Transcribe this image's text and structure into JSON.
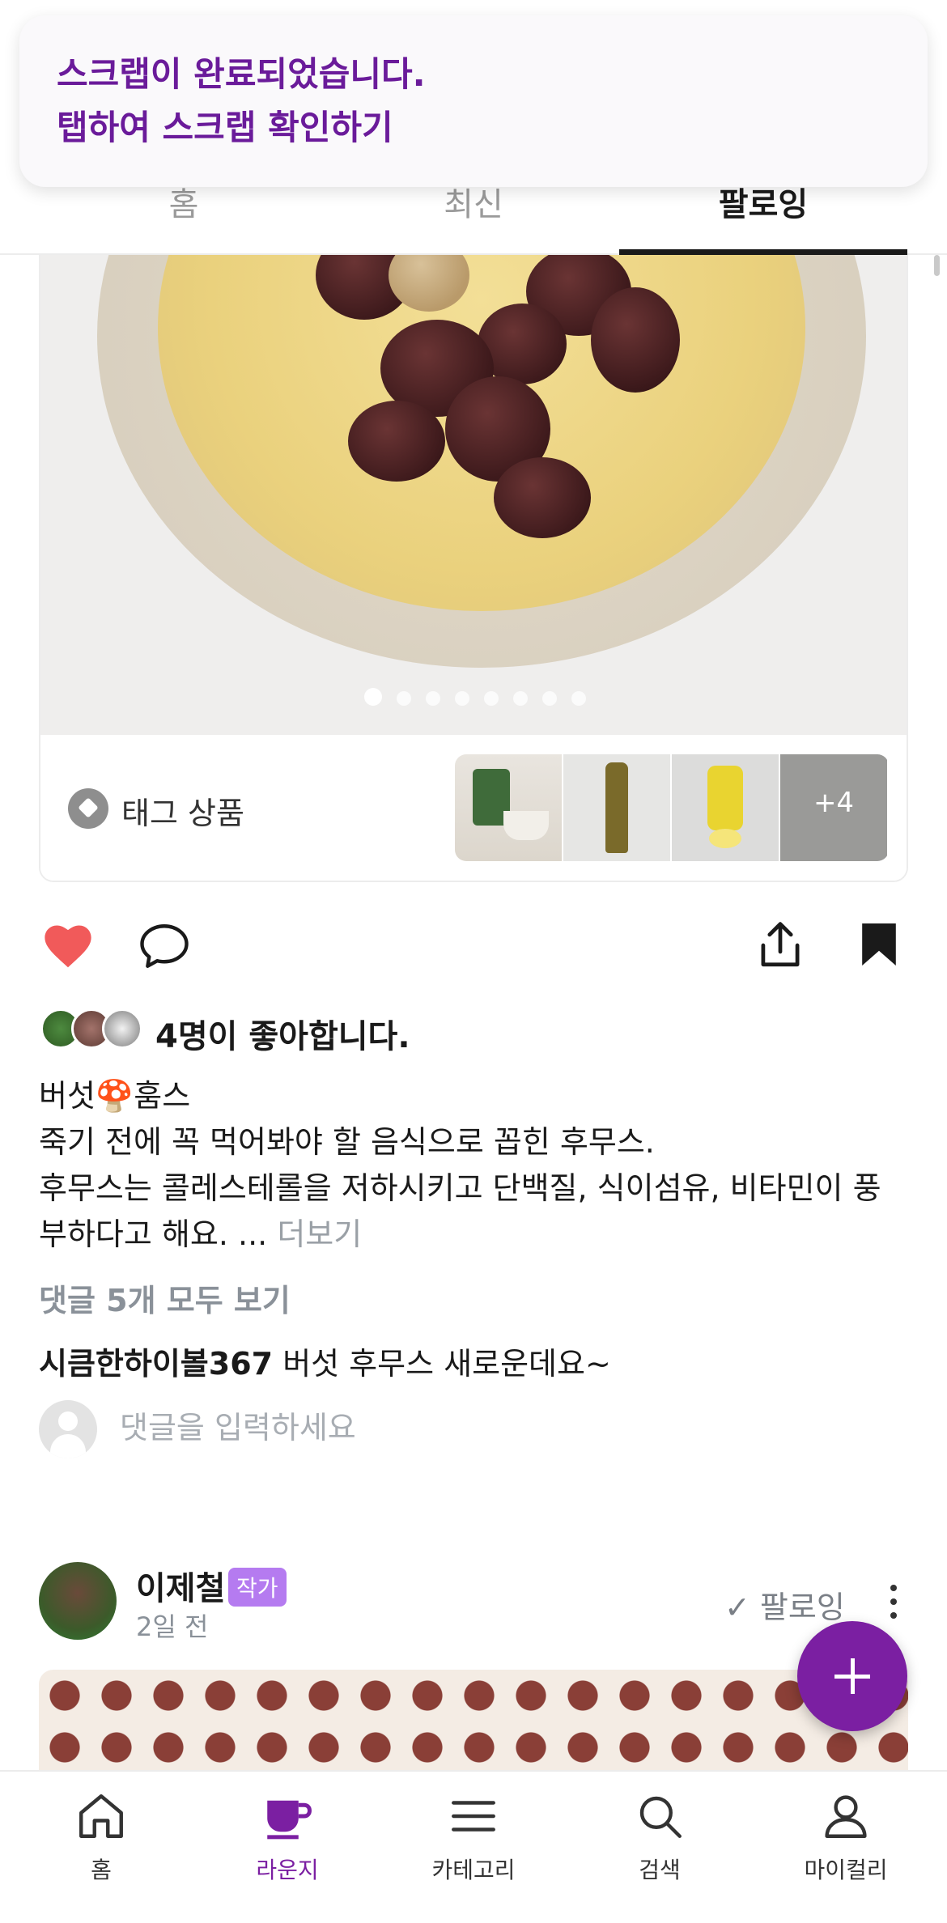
{
  "toast": {
    "line1": "스크랩이 완료되었습니다.",
    "line2": "탭하여 스크랩 확인하기"
  },
  "tabs": [
    {
      "label": "홈"
    },
    {
      "label": "최신"
    },
    {
      "label": "팔로잉",
      "active": true
    }
  ],
  "post": {
    "image_pages": 8,
    "image_current_page": 1,
    "tag_products": {
      "label": "태그 상품",
      "more_count": "+4"
    },
    "likes_text": "4명이 좋아합니다.",
    "caption_line1": "버섯🍄훔스",
    "caption_line2": "죽기 전에 꼭 먹어봐야 할 음식으로 꼽힌 후무스.",
    "caption_line3": "후무스는 콜레스테롤을 저하시키고 단백질, 식이섬유, 비타민이 풍",
    "caption_line4": "부하다고 해요. ...",
    "more_link": "더보기",
    "view_all_comments": "댓글 5개 모두 보기",
    "top_comment": {
      "user": "시큼한하이볼367",
      "text": "버섯 후무스 새로운데요~"
    },
    "comment_placeholder": "댓글을 입력하세요"
  },
  "next_post": {
    "author": "이제철",
    "badge": "작가",
    "time": "2일 전",
    "follow_label": "✓ 팔로잉"
  },
  "bottom_nav": [
    {
      "label": "홈",
      "icon": "home-icon"
    },
    {
      "label": "라운지",
      "icon": "cup-icon",
      "active": true
    },
    {
      "label": "카테고리",
      "icon": "menu-icon"
    },
    {
      "label": "검색",
      "icon": "search-icon"
    },
    {
      "label": "마이컬리",
      "icon": "person-icon"
    }
  ],
  "colors": {
    "accent": "#7b1fa2",
    "like": "#f15a5a",
    "badge": "#b57bf0"
  }
}
